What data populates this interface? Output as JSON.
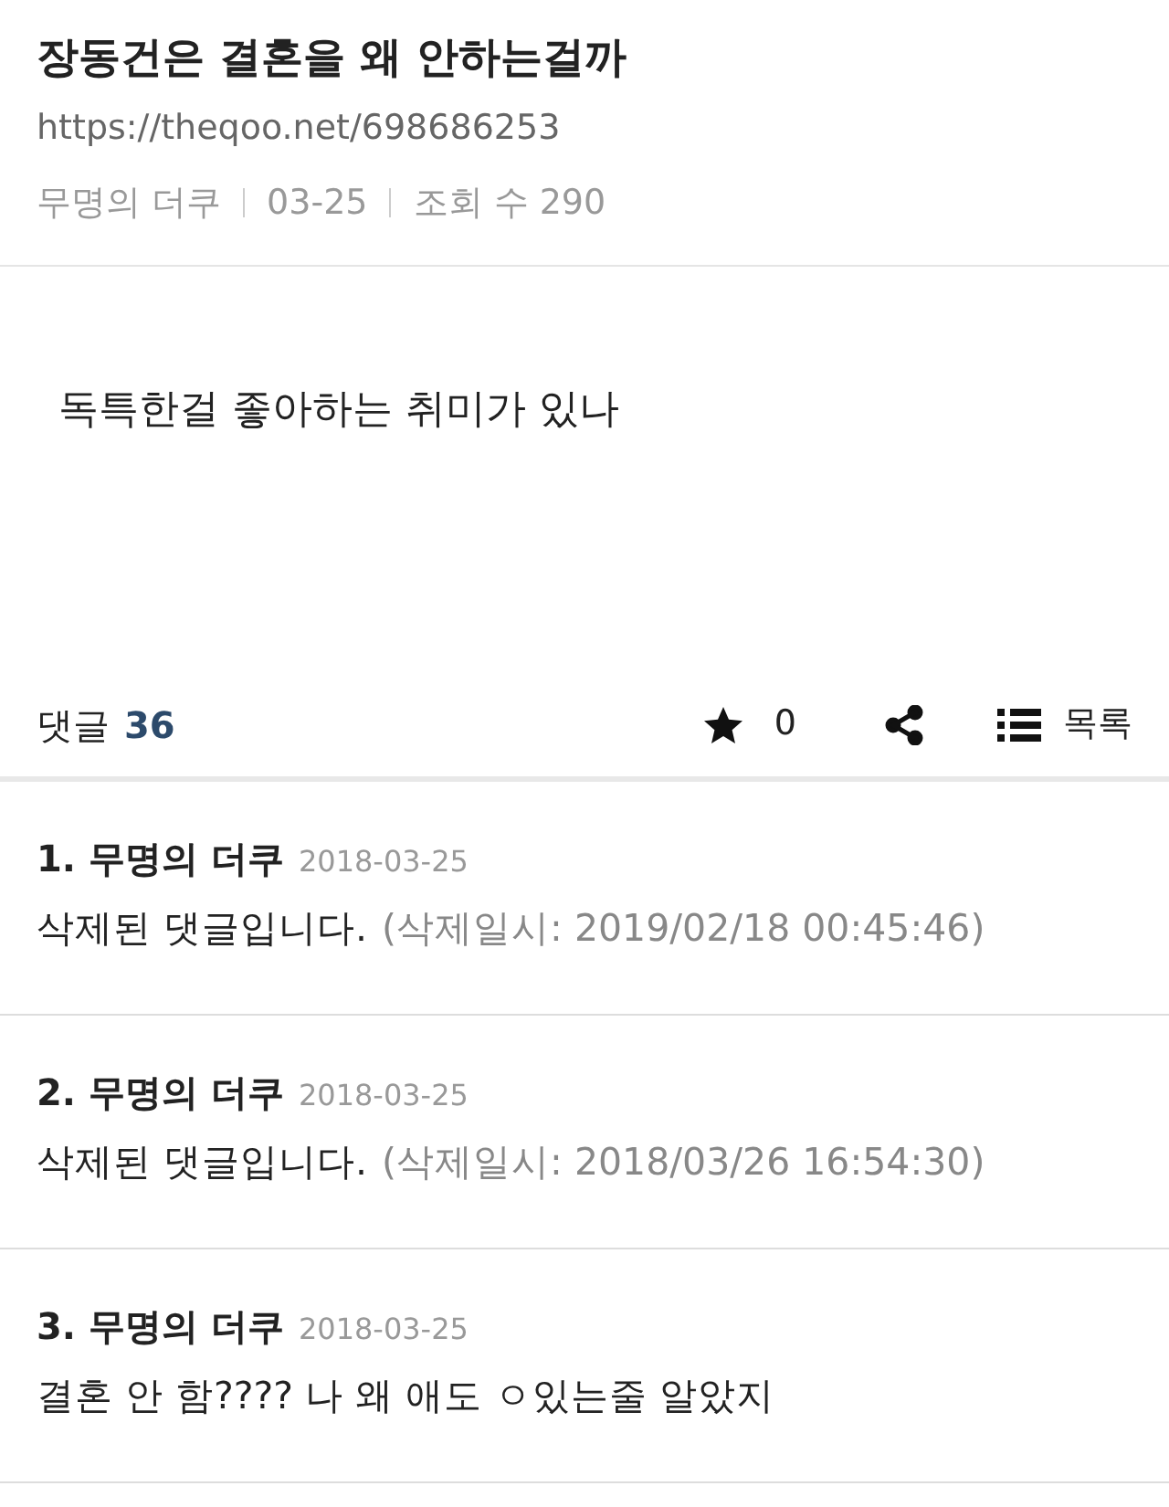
{
  "post": {
    "title": "장동건은 결혼을 왜 안하는걸까",
    "url": "https://theqoo.net/698686253",
    "meta": [
      "무명의 더쿠",
      "03-25",
      "조회 수 290"
    ],
    "body": "독특한걸 좋아하는 취미가 있나"
  },
  "toolbar": {
    "comments_label": "댓글",
    "comments_count": "36",
    "likes": "0",
    "list_label": "목록"
  },
  "comments": [
    {
      "number": "1.",
      "author": "무명의 더쿠",
      "date": "2018-03-25",
      "text": "삭제된 댓글입니다.",
      "note": "(삭제일시: 2019/02/18 00:45:46)"
    },
    {
      "number": "2.",
      "author": "무명의 더쿠",
      "date": "2018-03-25",
      "text": "삭제된 댓글입니다.",
      "note": "(삭제일시: 2018/03/26 16:54:30)"
    },
    {
      "number": "3.",
      "author": "무명의 더쿠",
      "date": "2018-03-25",
      "text": "결혼 안 함???? 나 왜 애도 ㅇ있는줄 알았지"
    }
  ]
}
